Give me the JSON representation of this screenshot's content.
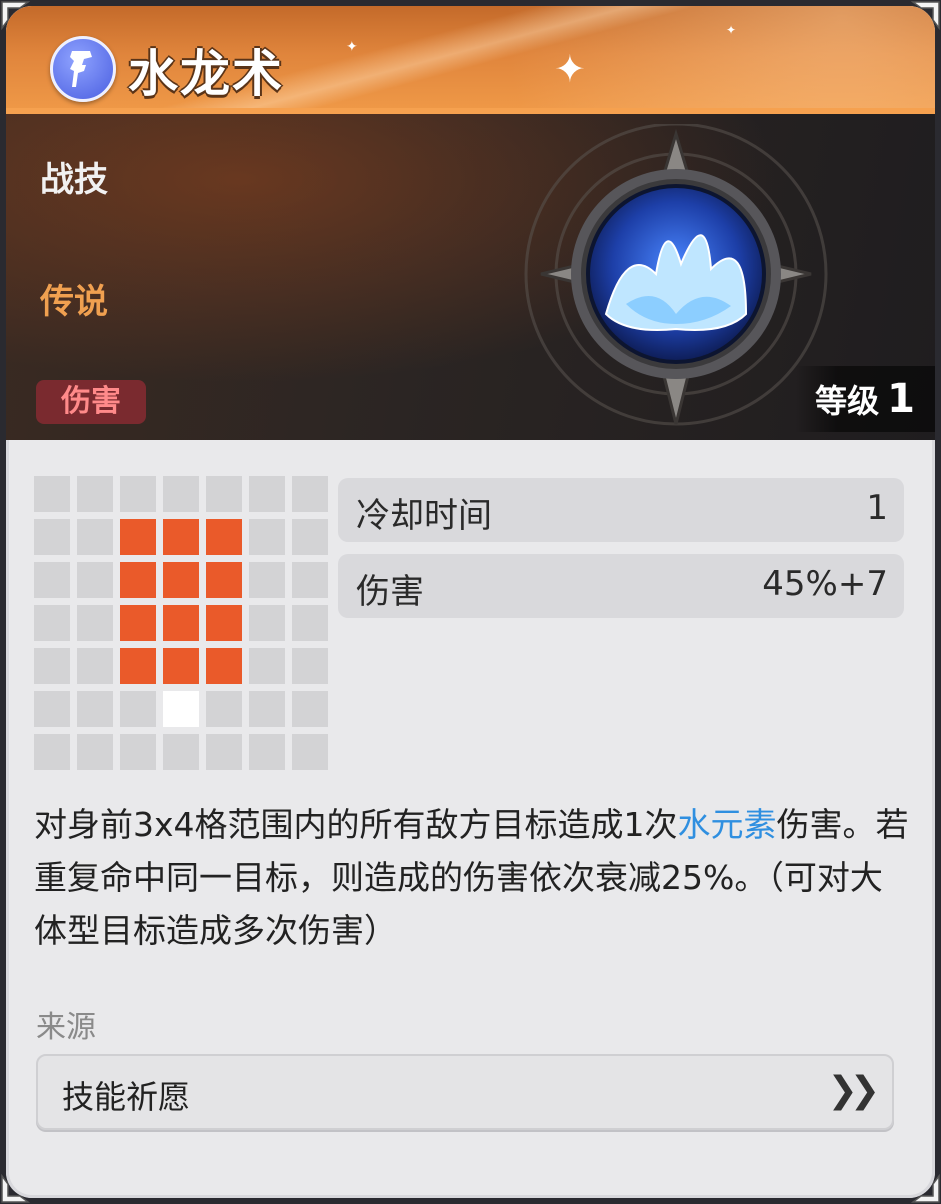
{
  "header": {
    "title": "水龙术",
    "type_icon": "staff-rune-icon"
  },
  "banner": {
    "skill_kind": "战技",
    "rarity": "传说",
    "tag": "伤害",
    "level_label": "等级",
    "level_value": "1",
    "skill_icon": "water-splash-icon"
  },
  "range_grid": {
    "rows": 7,
    "cols": 7,
    "cells": [
      "empty",
      "empty",
      "empty",
      "empty",
      "empty",
      "empty",
      "empty",
      "empty",
      "empty",
      "hit",
      "hit",
      "hit",
      "empty",
      "empty",
      "empty",
      "empty",
      "hit",
      "hit",
      "hit",
      "empty",
      "empty",
      "empty",
      "empty",
      "hit",
      "hit",
      "hit",
      "empty",
      "empty",
      "empty",
      "empty",
      "hit",
      "hit",
      "hit",
      "empty",
      "empty",
      "empty",
      "empty",
      "empty",
      "self",
      "empty",
      "empty",
      "empty",
      "empty",
      "empty",
      "empty",
      "empty",
      "empty",
      "empty",
      "empty"
    ],
    "colors": {
      "empty": "#d3d3d5",
      "hit": "#ea5a2a",
      "self": "#ffffff"
    }
  },
  "stats": [
    {
      "label": "冷却时间",
      "value": "1"
    },
    {
      "label": "伤害",
      "value": "45%+7"
    }
  ],
  "description": {
    "part1": "对身前3x4格范围内的所有敌方目标造成1次",
    "highlight": "水元素",
    "part2": "伤害。若重复命中同一目标，则造成的伤害依次衰减25%。（可对大体型目标造成多次伤害）",
    "highlight_color": "#2f8fe0"
  },
  "source": {
    "label": "来源",
    "button_label": "技能祈愿",
    "button_icon": "double-chevron-right-icon"
  }
}
